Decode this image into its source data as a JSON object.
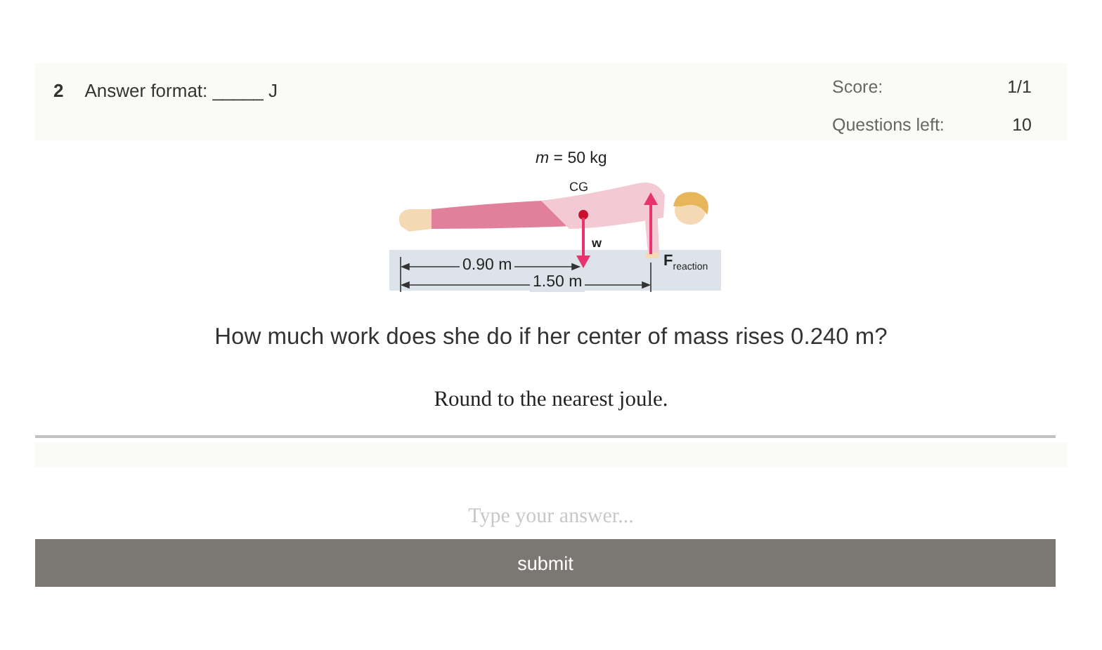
{
  "question": {
    "number": "2",
    "answer_format": "Answer format: _____ J"
  },
  "stats": [
    {
      "label": "Score:",
      "value": "1/1"
    },
    {
      "label": "Questions left:",
      "value": "10"
    }
  ],
  "figure": {
    "labels": [
      {
        "kind": "mass",
        "text": "*m* = 50 kg"
      },
      {
        "kind": "cg",
        "text": "CG"
      },
      {
        "kind": "weight",
        "text": "w"
      },
      {
        "kind": "short_span",
        "text": "0.90 m"
      },
      {
        "kind": "force",
        "text": "**F**$_{reaction}$"
      },
      {
        "kind": "long_span",
        "text": "1.50 m"
      }
    ]
  },
  "prompt": "How much work does she do if her center of mass rises 0.240 m?",
  "instruction": "Round to the nearest joule.",
  "answer": {
    "placeholder": "Type your answer..."
  },
  "submit": "submit"
}
